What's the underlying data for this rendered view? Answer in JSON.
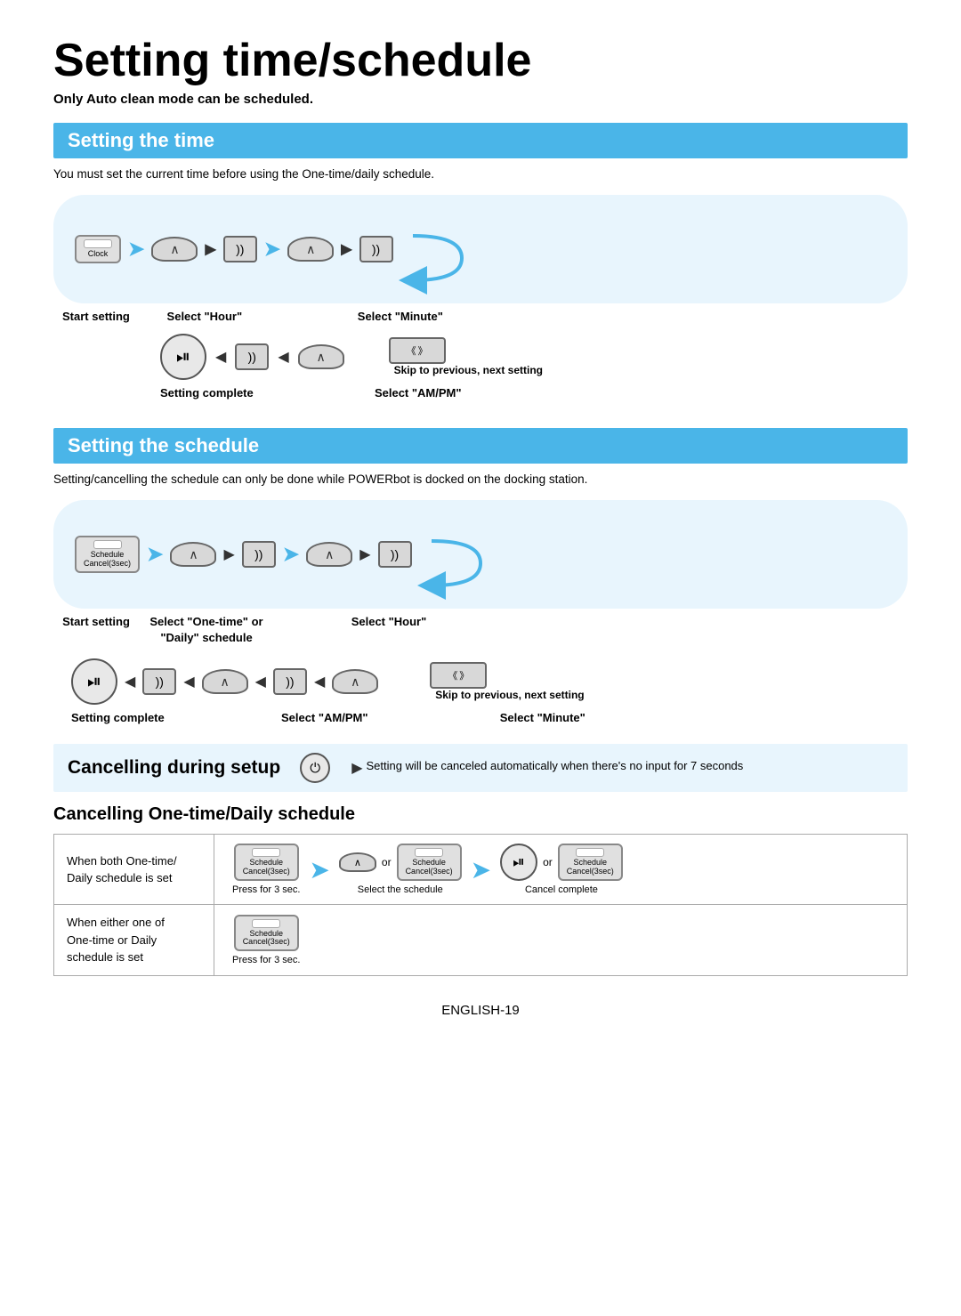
{
  "title": "Setting time/schedule",
  "subtitle": "Only Auto clean mode can be scheduled.",
  "section1": {
    "header": "Setting the time",
    "desc": "You must set the current time before using the One-time/daily schedule.",
    "row1_labels": {
      "start": "Start setting",
      "select_hour": "Select \"Hour\"",
      "select_minute": "Select \"Minute\""
    },
    "row2_labels": {
      "setting_complete": "Setting complete",
      "select_ampm": "Select \"AM/PM\"",
      "skip": "Skip to previous, next setting"
    }
  },
  "section2": {
    "header": "Setting the schedule",
    "desc": "Setting/cancelling the schedule can only be done while POWERbot is docked on the docking station.",
    "row1_labels": {
      "start": "Start setting",
      "select_onetime": "Select \"One-time\" or\n\"Daily\" schedule",
      "select_hour": "Select \"Hour\""
    },
    "row2_labels": {
      "setting_complete": "Setting complete",
      "select_ampm": "Select \"AM/PM\"",
      "select_minute": "Select \"Minute\"",
      "skip": "Skip to previous, next setting"
    }
  },
  "cancel_setup": {
    "header": "Cancelling during setup",
    "desc": "Setting will be canceled automatically when there's no input for 7 seconds"
  },
  "cancel_schedule": {
    "header": "Cancelling One-time/Daily schedule",
    "rows": [
      {
        "label": "When both One-time/\nDaily schedule is set",
        "items": [
          {
            "icon": "schedule",
            "label": "Schedule\nCancel(3sec)",
            "sub": "Press for 3 sec."
          },
          {
            "icon": "hat",
            "label": "",
            "sub": "Select the schedule"
          },
          {
            "icon": "playpause",
            "label": "",
            "sub": ""
          },
          {
            "icon": "schedule2",
            "label": "Schedule\nCancel(3sec)",
            "sub": "Cancel complete"
          }
        ]
      },
      {
        "label": "When either one of\nOne-time or Daily\nschedule is set",
        "items": [
          {
            "icon": "schedule3",
            "label": "Schedule\nCancel(3sec)",
            "sub": "Press for 3 sec."
          }
        ]
      }
    ]
  },
  "footer": "ENGLISH-19"
}
